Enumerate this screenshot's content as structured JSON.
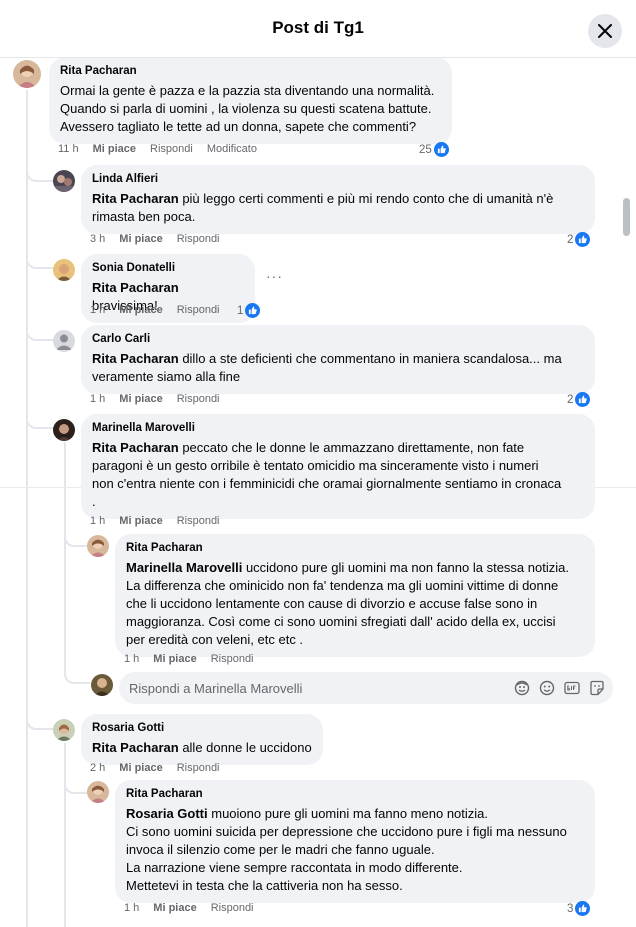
{
  "dialog": {
    "title": "Post di Tg1",
    "reply_placeholder": "Rispondi a Marinella Marovelli"
  },
  "labels": {
    "like": "Mi piace",
    "reply": "Rispondi",
    "edited": "Modificato"
  },
  "comments": [
    {
      "author": "Rita Pacharan",
      "lines": [
        "Ormai la gente è pazza e la pazzia sta diventando una normalità.",
        "Quando si parla di uomini , la violenza su questi scatena battute.",
        "Avessero tagliato le tette ad un donna, sapete che commenti?"
      ],
      "time": "11 h",
      "reactions": "25"
    },
    {
      "author": "Linda Alfieri",
      "mention": "Rita Pacharan",
      "lines": [
        " più leggo certi commenti e più mi rendo conto che di umanità n'è",
        "rimasta ben poca."
      ],
      "time": "3 h",
      "reactions": "2"
    },
    {
      "author": "Sonia Donatelli",
      "mention": "Rita Pacharan",
      "lines": [
        " bravissima!"
      ],
      "time": "1 h",
      "reactions": "1"
    },
    {
      "author": "Carlo Carli",
      "mention": "Rita Pacharan",
      "lines": [
        " dillo a ste deficienti che commentano in maniera scandalosa... ma",
        "veramente siamo alla fine"
      ],
      "time": "1 h",
      "reactions": "2"
    },
    {
      "author": "Marinella Marovelli",
      "mention": "Rita Pacharan",
      "lines": [
        " peccato che le donne le ammazzano direttamente, non fate",
        "paragoni è un gesto orribile è tentato omicidio ma sinceramente visto i numeri",
        "non c'entra niente con i femminicidi che oramai giornalmente sentiamo in cronaca",
        "."
      ],
      "time": "1 h"
    },
    {
      "author": "Rita Pacharan",
      "mention": "Marinella Marovelli",
      "lines": [
        " uccidono pure gli uomini ma non fanno la stessa notizia.",
        "La differenza che ominicido non fa' tendenza ma gli uomini vittime di donne",
        "che li uccidono lentamente con cause di divorzio e accuse false sono in",
        "maggioranza. Così come ci sono uomini sfregiati dall' acido della ex, uccisi",
        "per eredità con veleni, etc etc ."
      ],
      "time": "1 h"
    },
    {
      "author": "Rosaria Gotti",
      "mention": "Rita Pacharan",
      "lines": [
        " alle donne le uccidono"
      ],
      "time": "2 h"
    },
    {
      "author": "Rita Pacharan",
      "mention": "Rosaria Gotti",
      "lines": [
        " muoiono pure gli uomini ma fanno meno notizia.",
        "Ci sono uomini suicida per depressione che uccidono pure i figli ma nessuno",
        "invoca il silenzio come per le madri che fanno uguale.",
        "La narrazione viene sempre raccontata in modo differente.",
        "Mettetevi in testa che la cattiveria non ha sesso."
      ],
      "time": "1 h",
      "reactions": "3"
    }
  ],
  "icons": [
    "close-icon",
    "like-icon",
    "more-icon",
    "avatar-silhouette-icon",
    "emoji-icon",
    "avatar-sticker-icon",
    "gif-icon",
    "sticker-icon"
  ],
  "colors": {
    "accent": "#1877f2",
    "bubble": "#f0f2f5",
    "secondary_text": "#65676b"
  }
}
